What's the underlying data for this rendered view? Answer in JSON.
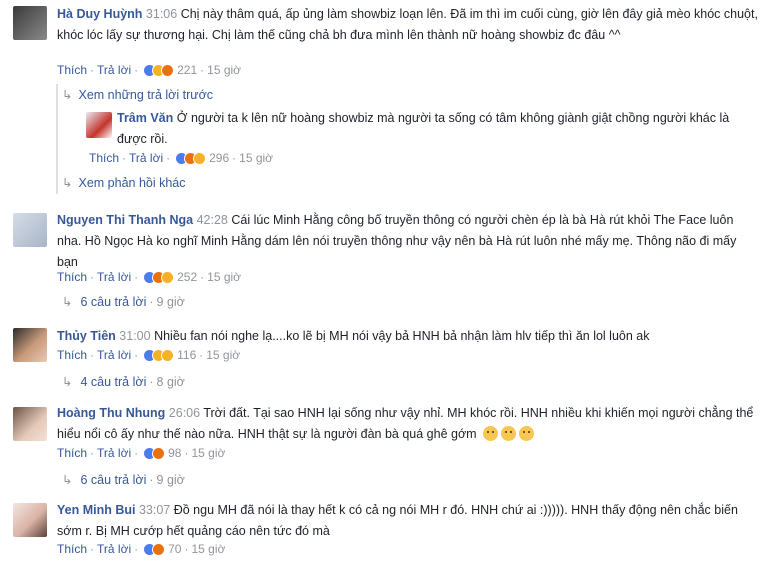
{
  "colors": {
    "link": "#365899",
    "muted": "#90949c",
    "like": "#4b7bec",
    "angry": "#e9710f",
    "sad": "#f7b125"
  },
  "comments": [
    {
      "name": "Hà Duy Huỳnh",
      "time": "31:06",
      "text": "Chị này thâm quá, ấp ủng làm showbiz loạn lên. Đã im thì im cuối cùng, giờ lên đây giả mèo khóc chuột, khóc lóc lấy sự thương hại. Chị làm thế cũng chả bh đưa mình lên thành nữ hoàng showbiz đc đâu ^^",
      "like": "Thích",
      "reply": "Trả lời",
      "count": "221",
      "age": "15 giờ",
      "reactions": [
        "like-icon",
        "sad-icon",
        "angry-icon"
      ]
    },
    {
      "view_prev": "Xem những trả lời trước",
      "name": "Trâm Văn",
      "time": "",
      "text": "Ở người ta k lên nữ hoàng showbiz mà người ta sống có tâm không giành giật chồng người khác là được rồi.",
      "like": "Thích",
      "reply": "Trả lời",
      "count": "296",
      "age": "15 giờ",
      "reactions": [
        "like-icon",
        "angry-icon",
        "haha-icon"
      ],
      "view_more": "Xem phản hồi khác"
    },
    {
      "name": "Nguyen Thi Thanh Nga",
      "time": "42:28",
      "text": "Cái lúc Minh Hằng công bố truyền thông có người chèn ép là bà Hà rút khỏi The Face luôn nha. Hồ Ngọc Hà ko nghĩ Minh Hằng dám lên nói truyền thông như vậy nên bà Hà rút luôn nhé mấy mẹ. Thông não đi mấy bạn",
      "like": "Thích",
      "reply": "Trả lời",
      "count": "252",
      "age": "15 giờ",
      "reactions": [
        "like-icon",
        "angry-icon",
        "haha-icon"
      ],
      "replies": "6 câu trả lời",
      "replies_age": "9 giờ"
    },
    {
      "name": "Thủy Tiên",
      "time": "31:00",
      "text": "Nhiều fan nói nghe lạ....ko lẽ bị MH nói vậy bả HNH bả nhận làm hlv tiếp thì ăn lol luôn ak",
      "like": "Thích",
      "reply": "Trả lời",
      "count": "116",
      "age": "15 giờ",
      "reactions": [
        "like-icon",
        "sad-icon",
        "haha-icon"
      ],
      "replies": "4 câu trả lời",
      "replies_age": "8 giờ"
    },
    {
      "name": "Hoàng Thu Nhung",
      "time": "26:06",
      "text": "Trời đất. Tại sao HNH lại sống như vậy nhỉ. MH khóc rồi. HNH nhiều khi khiến mọi người chẳng thể hiểu nổi cô ấy như thế nào nữa. HNH thật sự là người đàn bà quá ghê gớm",
      "like": "Thích",
      "reply": "Trả lời",
      "count": "98",
      "age": "15 giờ",
      "reactions": [
        "like-icon",
        "angry-icon"
      ],
      "replies": "6 câu trả lời",
      "replies_age": "9 giờ"
    },
    {
      "name": "Yen Minh Bui",
      "time": "33:07",
      "text": "Đồ ngu MH đã nói là thay hết k có cả ng nói MH r đó. HNH chứ ai :))))). HNH thấy động nên chắc biến sớm r. Bị MH cướp hết quảng cáo nên tức đó mà",
      "like": "Thích",
      "reply": "Trả lời",
      "count": "70",
      "age": "15 giờ",
      "reactions": [
        "like-icon",
        "angry-icon"
      ]
    }
  ]
}
